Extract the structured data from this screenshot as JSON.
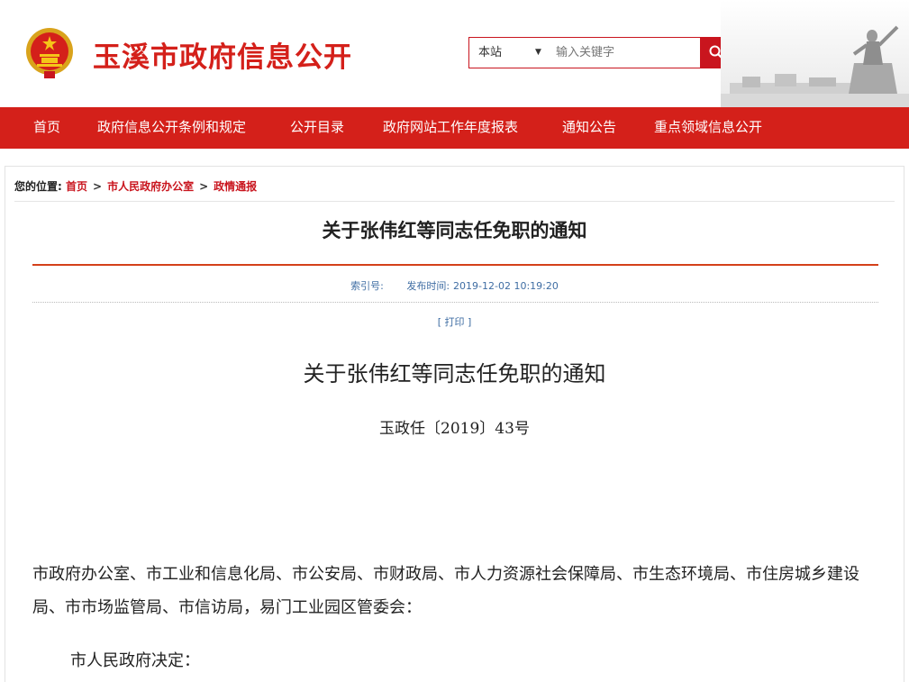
{
  "header": {
    "site_title": "玉溪市政府信息公开",
    "search": {
      "scope": "本站",
      "placeholder": "输入关键字",
      "button_label": "搜索"
    }
  },
  "nav": {
    "items": [
      {
        "label": "首页"
      },
      {
        "label": "政府信息公开条例和规定"
      },
      {
        "label": "公开目录"
      },
      {
        "label": "政府网站工作年度报表"
      },
      {
        "label": "通知公告"
      },
      {
        "label": "重点领域信息公开"
      }
    ]
  },
  "breadcrumb": {
    "prefix": "您的位置:",
    "items": [
      "首页",
      "市人民政府办公室",
      "政情通报"
    ],
    "separator": ">"
  },
  "article": {
    "title": "关于张伟红等同志任免职的通知",
    "index_label": "索引号:",
    "publish_label": "发布时间:",
    "publish_time": "2019-12-02 10:19:20",
    "print_label": "[ 打印 ]",
    "doc_title": "关于张伟红等同志任免职的通知",
    "doc_number": "玉政任〔2019〕43号",
    "recipients": "市政府办公室、市工业和信息化局、市公安局、市财政局、市人力资源社会保障局、市生态环境局、市住房城乡建设局、市市场监管局、市信访局，易门工业园区管委会：",
    "decision_text": "市人民政府决定："
  },
  "colors": {
    "brand_red": "#d4201a",
    "link_blue": "#3f6da3"
  }
}
